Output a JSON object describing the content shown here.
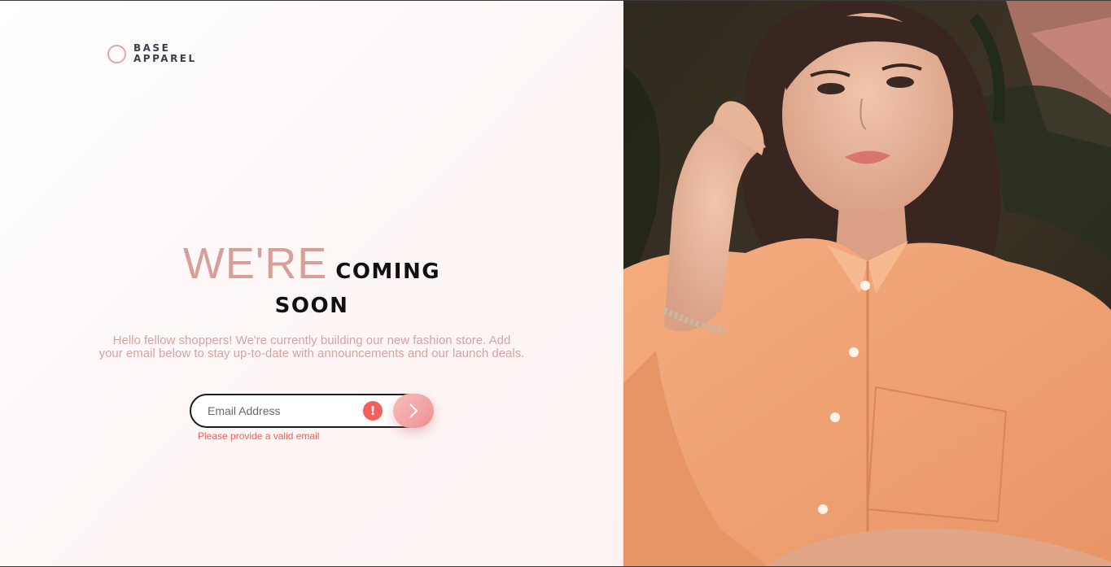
{
  "brand": {
    "line1": "BASE",
    "line2": "APPAREL"
  },
  "headline": {
    "light": "WE'RE",
    "bold_line1": "COMING",
    "bold_line2": "SOON"
  },
  "intro": {
    "line1": "Hello fellow shoppers! We're currently building our new fashion store. Add",
    "line2": "your email below to stay up-to-date with announcements and our launch deals."
  },
  "form": {
    "email_placeholder": "Email Address",
    "error_icon_glyph": "!",
    "error_message": "Please provide a valid email",
    "submit_icon": "chevron-right-icon"
  },
  "colors": {
    "accent": "#d79e9a",
    "error": "#f25f5c",
    "button_gradient_start": "#f8bfbf",
    "button_gradient_end": "#ee8f8f",
    "shirt": "#f2a475"
  },
  "hero_image": {
    "icon": "woman-portrait-photo"
  }
}
